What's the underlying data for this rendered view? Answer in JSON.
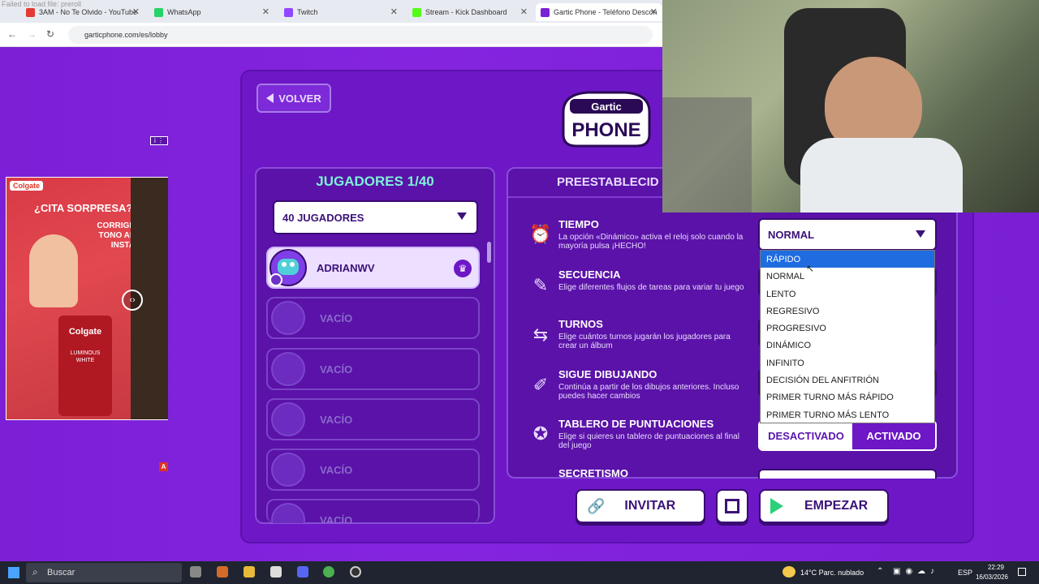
{
  "browser": {
    "fail_message": "Failed to load file: preroll",
    "tabs": [
      {
        "label": "3AM - No Te Olvido - YouTube",
        "color": "#e53935"
      },
      {
        "label": "WhatsApp",
        "color": "#25d366"
      },
      {
        "label": "Twitch",
        "color": "#9146ff"
      },
      {
        "label": "Stream - Kick Dashboard",
        "color": "#53fc18"
      },
      {
        "label": "Gartic Phone - Teléfono Descon",
        "color": "#7b20d6"
      }
    ],
    "url": "garticphone.com/es/lobby"
  },
  "game": {
    "back_label": "VOLVER",
    "logo_top": "Gartic",
    "logo_bottom": "PHONE",
    "players_title": "JUGADORES 1/40",
    "players_select": "40 JUGADORES",
    "players": [
      {
        "name": "ADRIANWV"
      },
      {
        "name": "VACÍO"
      },
      {
        "name": "VACÍO"
      },
      {
        "name": "VACÍO"
      },
      {
        "name": "VACÍO"
      },
      {
        "name": "VACÍO"
      }
    ],
    "settings_head": "PREESTABLECID",
    "settings": [
      {
        "title": "TIEMPO",
        "desc": "La opción «Dinámico» activa el reloj solo cuando la mayoría pulsa ¡HECHO!"
      },
      {
        "title": "SECUENCIA",
        "desc": "Elige diferentes flujos de tareas para variar tu juego"
      },
      {
        "title": "TURNOS",
        "desc": "Elige cuántos turnos jugarán los jugadores para crear un álbum"
      },
      {
        "title": "SIGUE DIBUJANDO",
        "desc": "Continúa a partir de los dibujos anteriores. Incluso puedes hacer cambios"
      },
      {
        "title": "TABLERO DE PUNTUACIONES",
        "desc": "Elige si quieres un tablero de puntuaciones al final del juego"
      },
      {
        "title": "SECRETISMO",
        "desc": ""
      }
    ],
    "time_select": "NORMAL",
    "time_options": [
      "RÁPIDO",
      "NORMAL",
      "LENTO",
      "REGRESIVO",
      "PROGRESIVO",
      "DINÁMICO",
      "INFINITO",
      "DECISIÓN DEL ANFITRIÓN",
      "PRIMER TURNO MÁS RÁPIDO",
      "PRIMER TURNO MÁS LENTO"
    ],
    "scoreboard_off": "DESACTIVADO",
    "scoreboard_on": "ACTIVADO",
    "invite_label": "INVITAR",
    "start_label": "EMPEZAR"
  },
  "ad": {
    "headline": "¿CITA SORPRESA?",
    "brand": "Colgate",
    "sub": "CORRIGE TONO AL INSTA",
    "product": "LUMINOUS WHITE",
    "badge": "A"
  },
  "taskbar": {
    "search": "Buscar",
    "weather": "14°C  Parc. nublado",
    "lang": "ESP",
    "time": "22:29",
    "date": "16/03/2026"
  }
}
